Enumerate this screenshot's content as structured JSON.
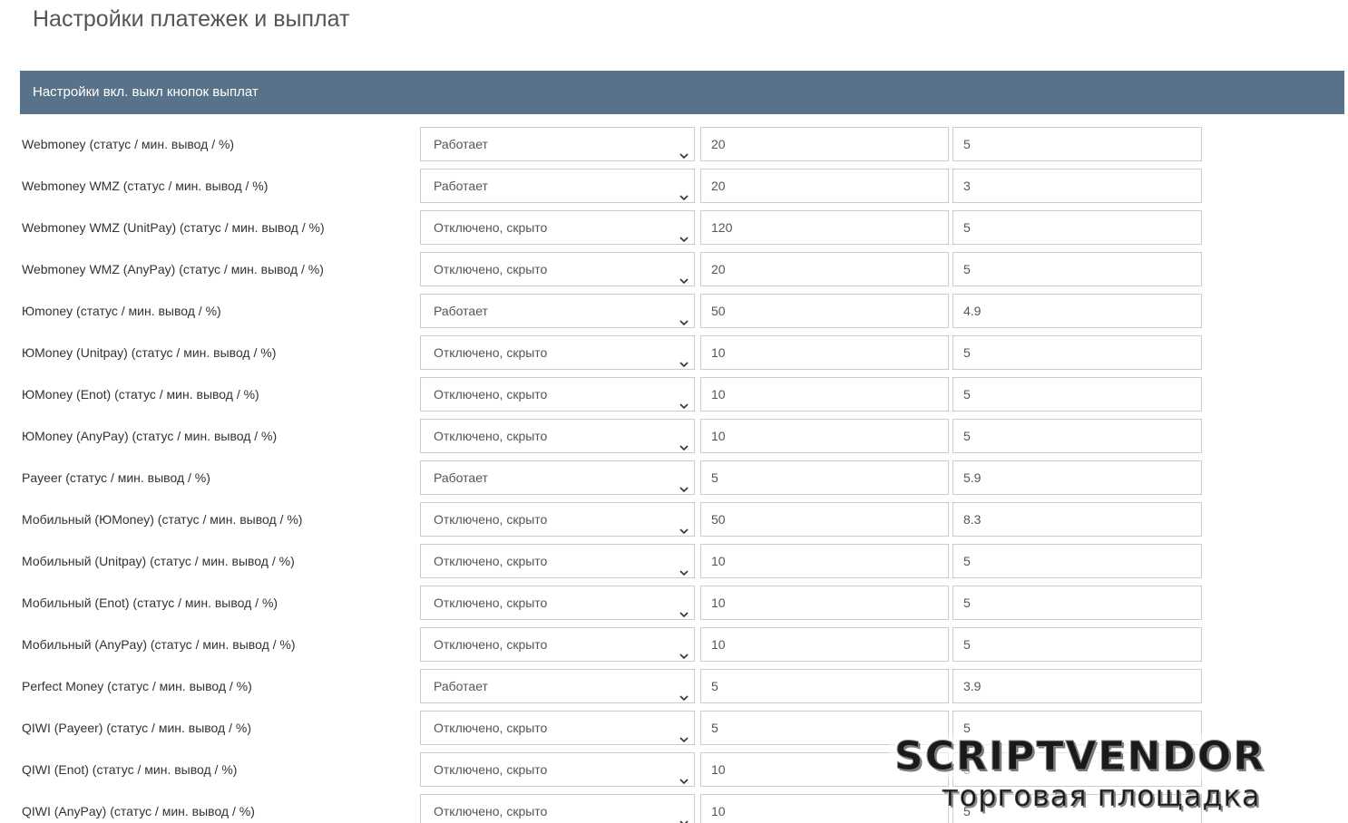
{
  "page": {
    "title": "Настройки платежек и выплат"
  },
  "panel": {
    "title": "Настройки вкл. выкл кнопок выплат"
  },
  "colors": {
    "header_bg": "#587389",
    "border": "#cccccc"
  },
  "rows": [
    {
      "label": "Webmoney (статус / мин. вывод / %)",
      "status": "Работает",
      "min": "20",
      "percent": "5"
    },
    {
      "label": "Webmoney WMZ (статус / мин. вывод / %)",
      "status": "Работает",
      "min": "20",
      "percent": "3"
    },
    {
      "label": "Webmoney WMZ (UnitPay) (статус / мин. вывод / %)",
      "status": "Отключено, скрыто",
      "min": "120",
      "percent": "5"
    },
    {
      "label": "Webmoney WMZ (AnyPay) (статус / мин. вывод / %)",
      "status": "Отключено, скрыто",
      "min": "20",
      "percent": "5"
    },
    {
      "label": "Юmoney (статус / мин. вывод / %)",
      "status": "Работает",
      "min": "50",
      "percent": "4.9"
    },
    {
      "label": "ЮMoney (Unitpay) (статус / мин. вывод / %)",
      "status": "Отключено, скрыто",
      "min": "10",
      "percent": "5"
    },
    {
      "label": "ЮMoney (Enot) (статус / мин. вывод / %)",
      "status": "Отключено, скрыто",
      "min": "10",
      "percent": "5"
    },
    {
      "label": "ЮMoney (AnyPay) (статус / мин. вывод / %)",
      "status": "Отключено, скрыто",
      "min": "10",
      "percent": "5"
    },
    {
      "label": "Payeer (статус / мин. вывод / %)",
      "status": "Работает",
      "min": "5",
      "percent": "5.9"
    },
    {
      "label": "Мобильный (ЮMoney) (статус / мин. вывод / %)",
      "status": "Отключено, скрыто",
      "min": "50",
      "percent": "8.3"
    },
    {
      "label": "Мобильный (Unitpay) (статус / мин. вывод / %)",
      "status": "Отключено, скрыто",
      "min": "10",
      "percent": "5"
    },
    {
      "label": "Мобильный (Enot) (статус / мин. вывод / %)",
      "status": "Отключено, скрыто",
      "min": "10",
      "percent": "5"
    },
    {
      "label": "Мобильный (AnyPay) (статус / мин. вывод / %)",
      "status": "Отключено, скрыто",
      "min": "10",
      "percent": "5"
    },
    {
      "label": "Perfect Money (статус / мин. вывод / %)",
      "status": "Работает",
      "min": "5",
      "percent": "3.9"
    },
    {
      "label": "QIWI (Payeer) (статус / мин. вывод / %)",
      "status": "Отключено, скрыто",
      "min": "5",
      "percent": "5"
    },
    {
      "label": "QIWI (Enot) (статус / мин. вывод / %)",
      "status": "Отключено, скрыто",
      "min": "10",
      "percent": "5"
    },
    {
      "label": "QIWI (AnyPay) (статус / мин. вывод / %)",
      "status": "Отключено, скрыто",
      "min": "10",
      "percent": "5"
    }
  ],
  "watermark": {
    "brand": "SCRIPTVENDOR",
    "subtitle": "торговая площадка"
  }
}
